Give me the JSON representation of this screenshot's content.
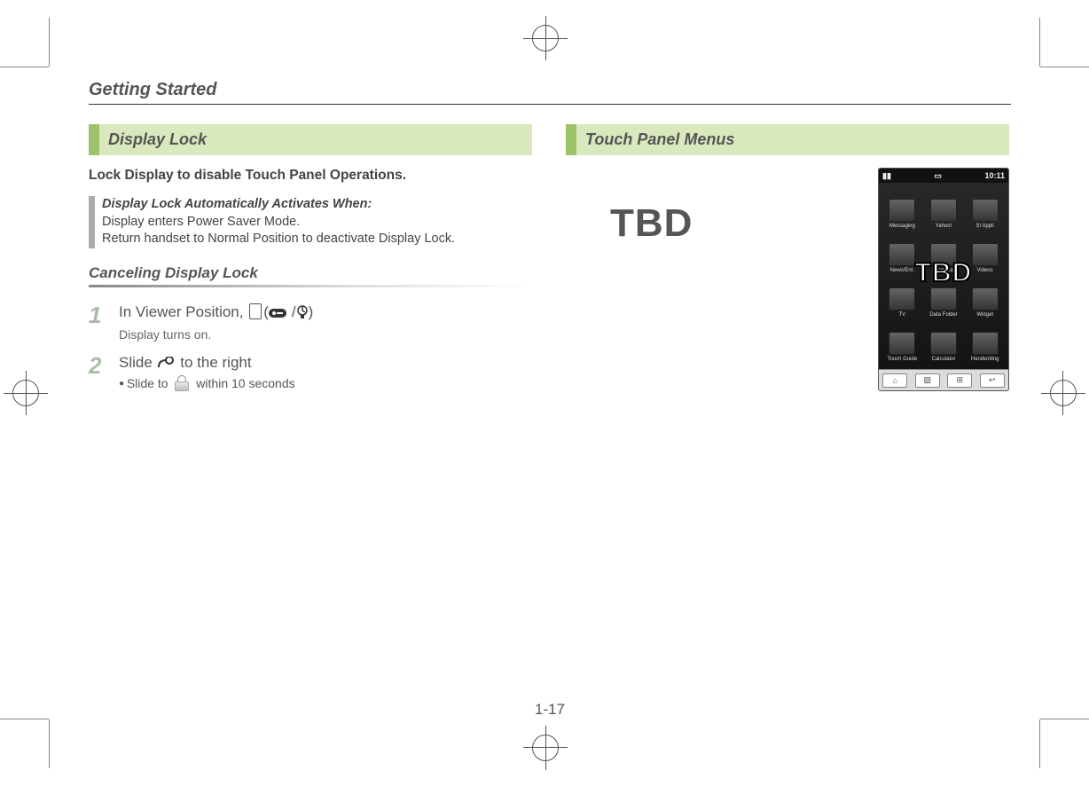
{
  "header": {
    "breadcrumb": "Getting Started"
  },
  "left": {
    "banner": "Display Lock",
    "lead": "Lock Display to disable Touch Panel Operations.",
    "note": {
      "title": "Display Lock Automatically Activates When:",
      "line1": "Display enters Power Saver Mode.",
      "line2": "Return handset to Normal Position to deactivate Display Lock."
    },
    "subhead": "Canceling Display Lock",
    "step1": {
      "num": "1",
      "text_a": "In Viewer Position, ",
      "text_b": "(",
      "text_c": "/",
      "text_d": ")",
      "sub": "Display turns on."
    },
    "step2": {
      "num": "2",
      "text_a": "Slide ",
      "text_b": " to the right",
      "bullet_a": "Slide to ",
      "bullet_b": " within 10 seconds"
    }
  },
  "right": {
    "banner": "Touch Panel Menus",
    "tbd": "TBD",
    "phone": {
      "time": "10:11",
      "tbd": "TBD",
      "apps": [
        "Messaging",
        "Yahoo!",
        "S! Appli",
        "News/Ent.",
        "Camera",
        "Videos",
        "TV",
        "Data Folder",
        "Widget",
        "Touch Guide",
        "Calculator",
        "Handwriting"
      ],
      "btn_home": "⌂",
      "btn_pic": "▧",
      "btn_grid": "⊞",
      "btn_back": "↩"
    }
  },
  "page_number": "1-17"
}
